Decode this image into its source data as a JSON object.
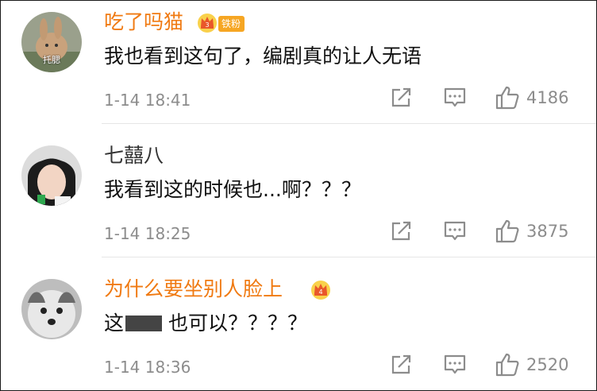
{
  "comments": [
    {
      "username": "吃了吗猫",
      "fan_badge": "铁粉",
      "avatar_caption": "托腮",
      "text": "我也看到这句了，编剧真的让人无语",
      "timestamp": "1-14 18:41",
      "likes": "4186"
    },
    {
      "username": "七囍八",
      "text": "我看到这的时候也...啊？？？",
      "timestamp": "1-14 18:25",
      "likes": "3875"
    },
    {
      "username": "为什么要坐别人脸上",
      "text_before": "这",
      "text_after": "也可以？？？？",
      "timestamp": "1-14 18:36",
      "likes": "2520"
    }
  ],
  "icons": {
    "share": "share-icon",
    "reply": "comment-icon",
    "like": "thumbs-up-icon",
    "crown": "vip-crown-icon"
  },
  "colors": {
    "vip_name": "#f07a12",
    "badge": "#f6a623",
    "meta": "#8c8c8c"
  }
}
